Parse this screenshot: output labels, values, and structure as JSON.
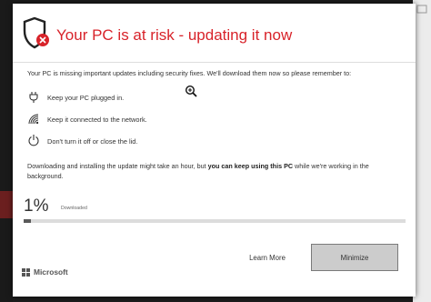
{
  "dialog": {
    "title": "Your PC is at risk - updating it now",
    "intro": "Your PC is missing important updates including security fixes. We'll download them now so please remember to:",
    "items": [
      {
        "label": "Keep your PC plugged in.",
        "icon": "power-plug-icon"
      },
      {
        "label": "Keep it connected to the network.",
        "icon": "wifi-icon"
      },
      {
        "label": "Don't turn it off or close the lid.",
        "icon": "power-icon"
      }
    ],
    "note_prefix": "Downloading and installing the update might take an hour, but ",
    "note_bold": "you can keep using this PC",
    "note_suffix": " while we're working in the background.",
    "progress": {
      "percent_label": "1%",
      "status": "Downloaded",
      "value": 0.01
    },
    "buttons": {
      "learn_more": "Learn More",
      "minimize": "Minimize"
    },
    "brand": "Microsoft"
  },
  "colors": {
    "title": "#d8232a",
    "badge": "#d8232a",
    "progress_fill": "#5a5a5a",
    "progress_track": "#dcdcdc",
    "minimize_bg": "#cccccc"
  },
  "icons": [
    "shield-warning-icon",
    "zoom-in-icon",
    "microsoft-logo-icon"
  ]
}
